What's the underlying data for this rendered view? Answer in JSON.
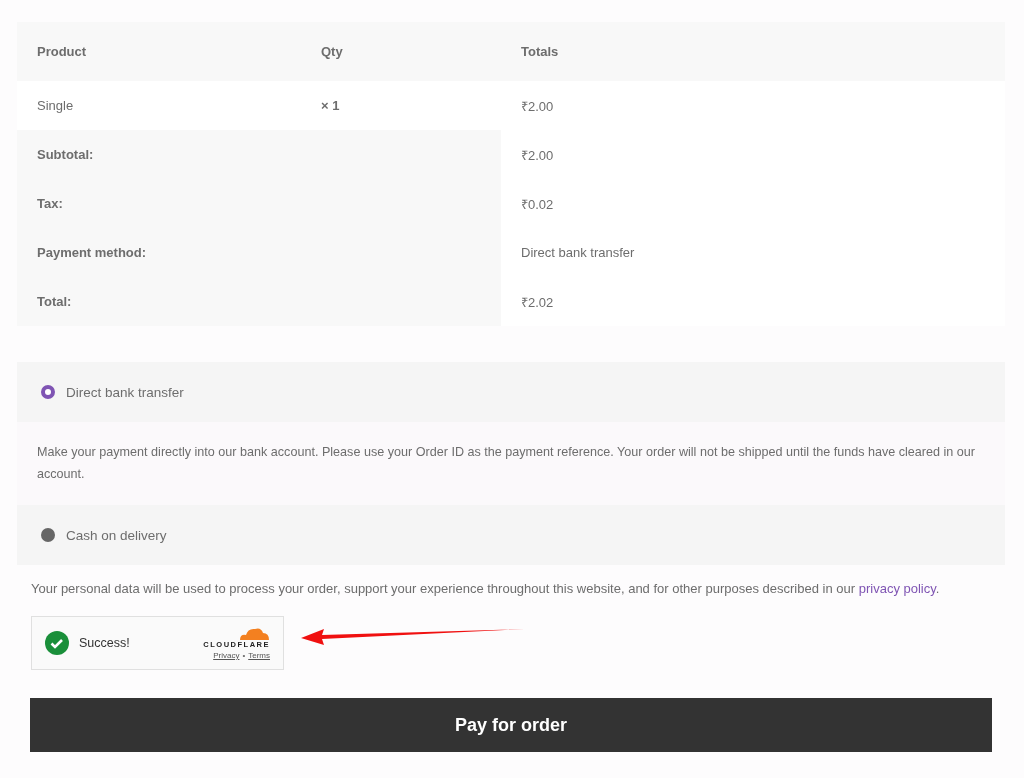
{
  "order_table": {
    "columns": [
      "Product",
      "Qty",
      "Totals"
    ],
    "rows": [
      {
        "product": "Single",
        "qty": "× 1",
        "total": "₹2.00"
      }
    ],
    "totals": [
      {
        "label": "Subtotal:",
        "value": "₹2.00"
      },
      {
        "label": "Tax:",
        "value": "₹0.02"
      },
      {
        "label": "Payment method:",
        "value": "Direct bank transfer"
      },
      {
        "label": "Total:",
        "value": "₹2.02"
      }
    ]
  },
  "payment_methods": [
    {
      "label": "Direct bank transfer",
      "selected": true,
      "description": "Make your payment directly into our bank account. Please use your Order ID as the payment reference. Your order will not be shipped until the funds have cleared in our account."
    },
    {
      "label": "Cash on delivery",
      "selected": false
    }
  ],
  "privacy_notice": {
    "text": "Your personal data will be used to process your order, support your experience throughout this website, and for other purposes described in our",
    "link": "privacy policy",
    "end": "."
  },
  "captcha": {
    "status": "Success!",
    "brand": "CLOUDFLARE",
    "links": [
      "Privacy",
      "Terms"
    ],
    "separator": "•"
  },
  "pay_button": "Pay for order"
}
